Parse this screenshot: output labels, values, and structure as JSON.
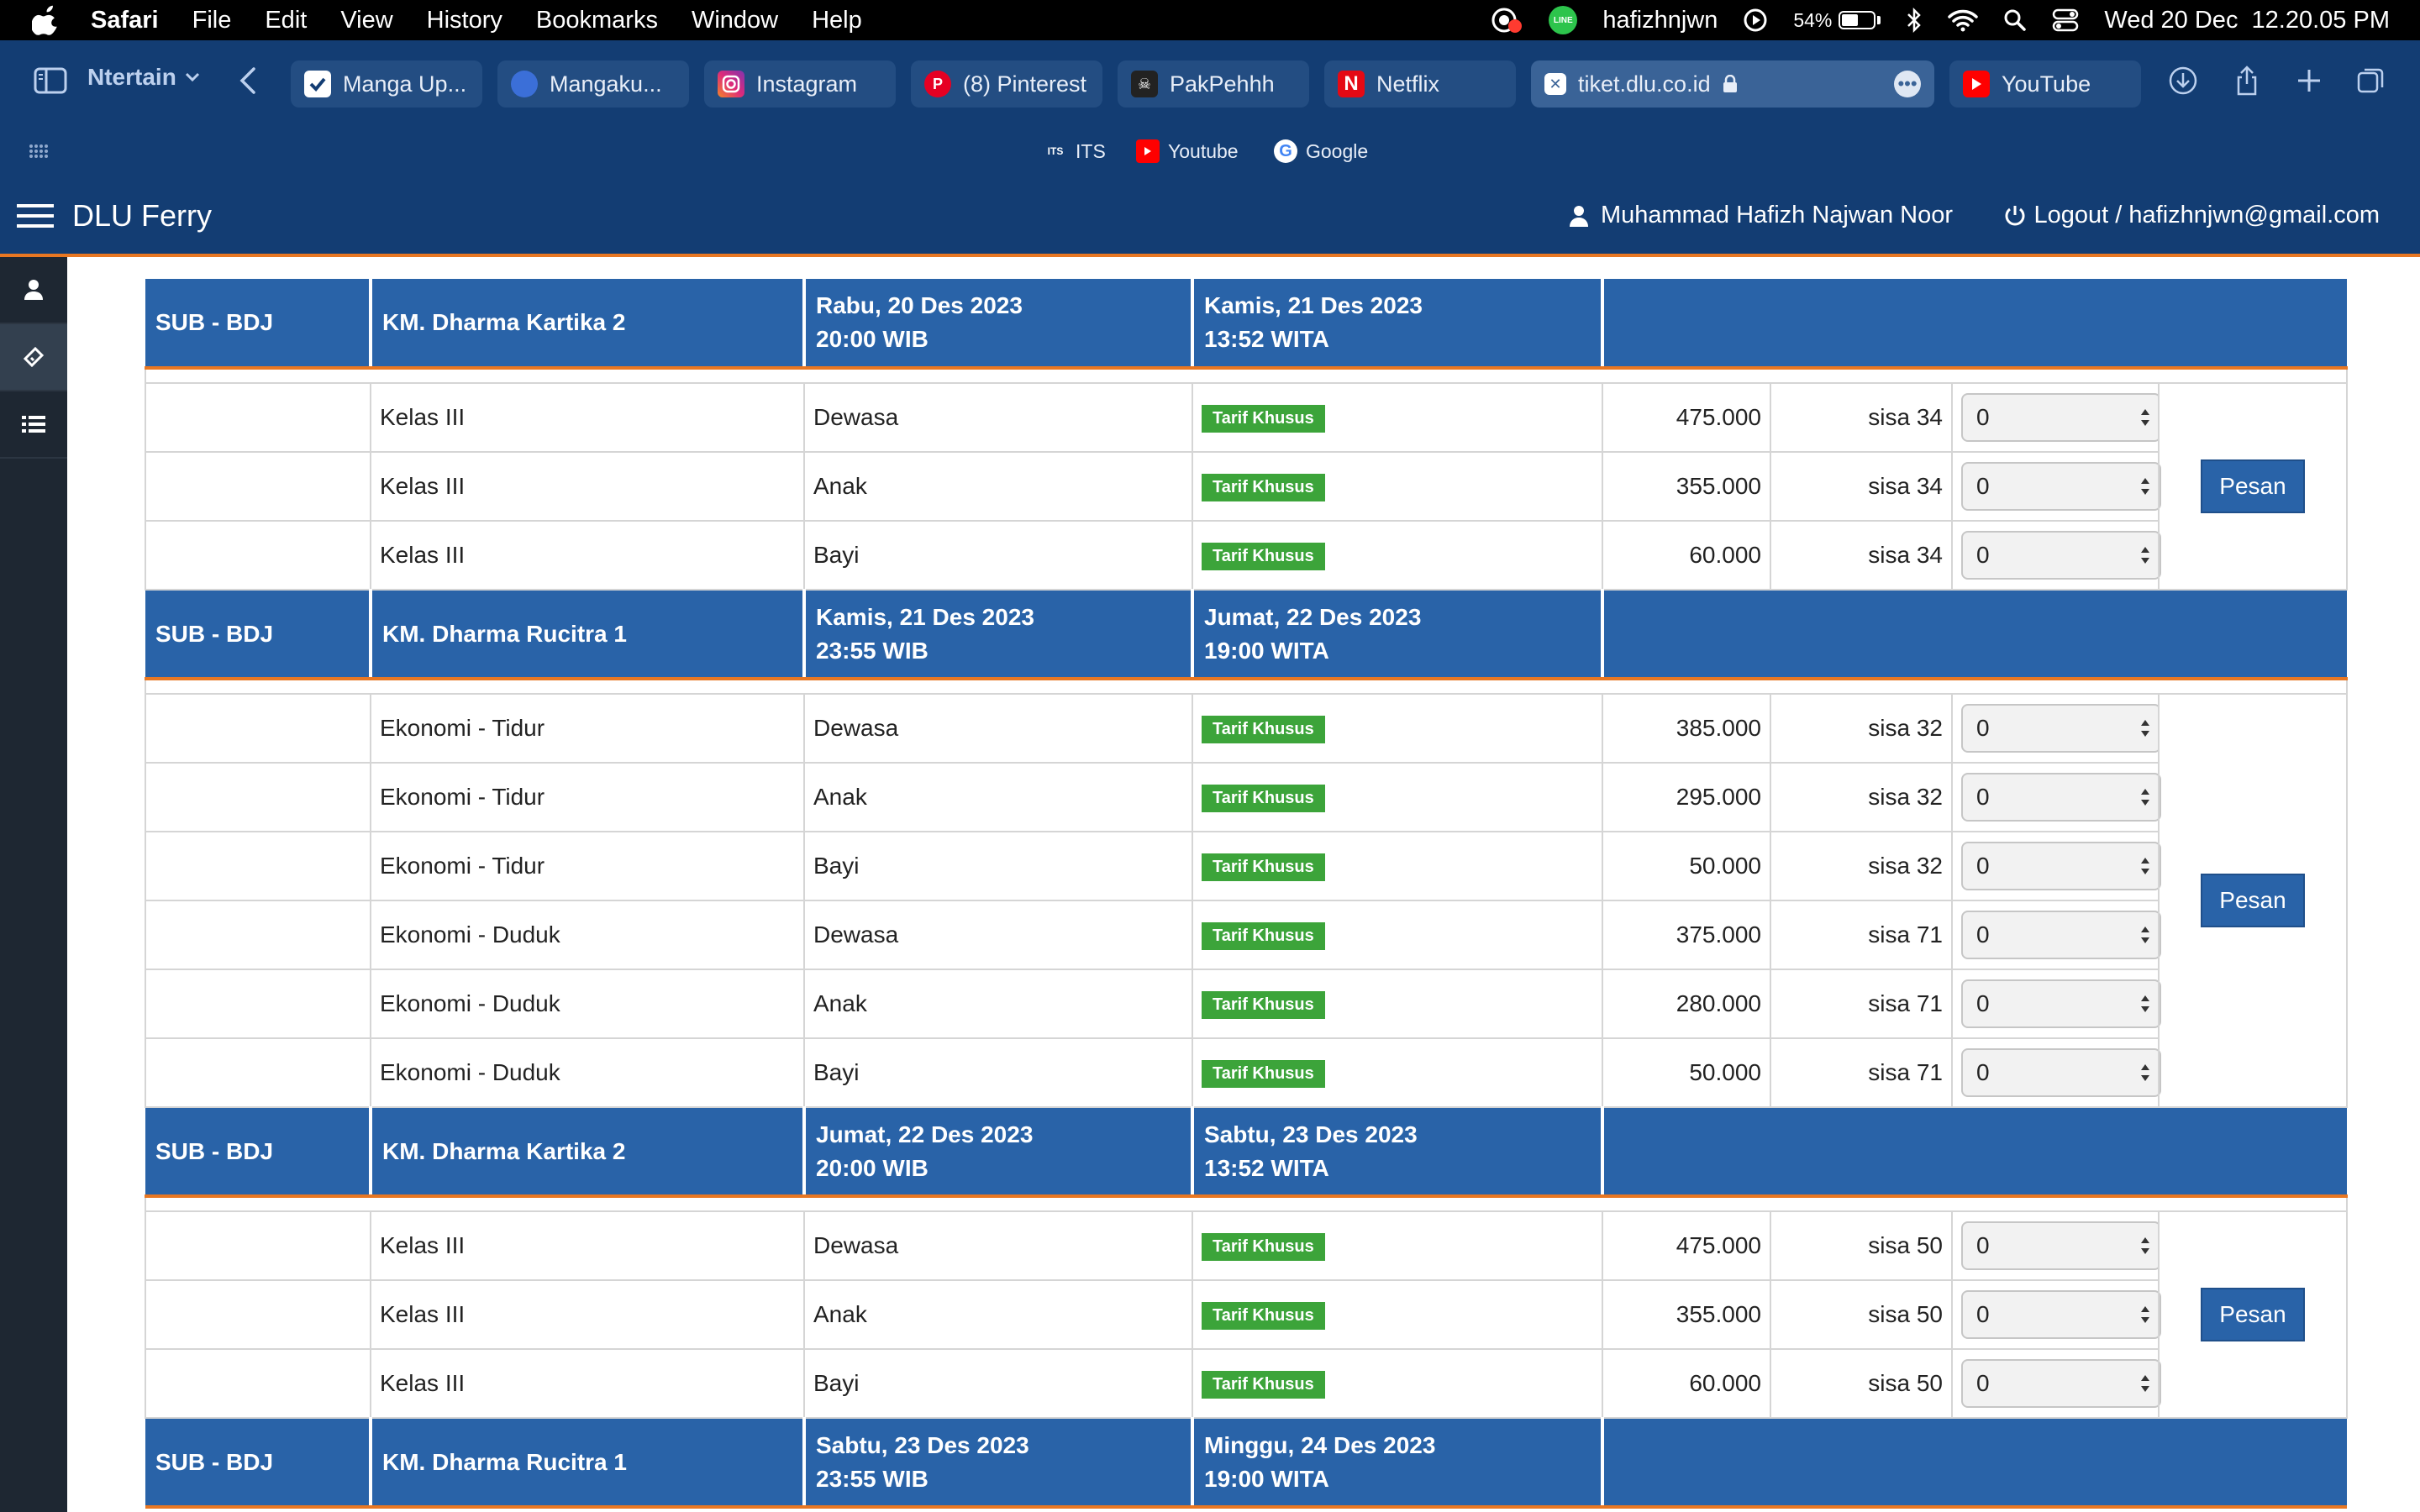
{
  "menubar": {
    "app": "Safari",
    "items": [
      "File",
      "Edit",
      "View",
      "History",
      "Bookmarks",
      "Window",
      "Help"
    ],
    "user": "hafizhnjwn",
    "battery_pct": "54%",
    "battery_level": 0.54,
    "datetime": "Wed 20 Dec  12.20.05 PM"
  },
  "toolbar": {
    "profile": "Ntertain",
    "tabs": [
      {
        "label": "Manga Up...",
        "icon": "manga-up-icon",
        "color": "#ffffff"
      },
      {
        "label": "Mangaku...",
        "icon": "mangaku-icon",
        "color": "#3b6fd8"
      },
      {
        "label": "Instagram",
        "icon": "instagram-icon",
        "color": "#d6249f"
      },
      {
        "label": "(8) Pinterest",
        "icon": "pinterest-icon",
        "color": "#e60023"
      },
      {
        "label": "PakPehhh",
        "icon": "pakpehhh-icon",
        "color": "#222222"
      },
      {
        "label": "Netflix",
        "icon": "netflix-icon",
        "color": "#e50914"
      },
      {
        "label": "tiket.dlu.co.id",
        "icon": "dlu-icon",
        "color": "#ffffff"
      },
      {
        "label": "YouTube",
        "icon": "youtube-icon",
        "color": "#ff0000"
      }
    ]
  },
  "favorites": [
    {
      "label": "ITS",
      "icon": "its-icon"
    },
    {
      "label": "Youtube",
      "icon": "youtube-icon"
    },
    {
      "label": "Google",
      "icon": "google-icon"
    }
  ],
  "site": {
    "brand": "DLU Ferry",
    "user_name": "Muhammad Hafizh Najwan Noor",
    "logout": "Logout / hafizhnjwn@gmail.com"
  },
  "colors": {
    "header_blue": "#133d73",
    "row_blue": "#2963a8",
    "accent_orange": "#e87722",
    "tarif_green": "#3ca43a"
  },
  "trips": [
    {
      "route": "SUB - BDJ",
      "ship": "KM. Dharma Kartika 2",
      "depart": [
        "Rabu, 20 Des 2023",
        "20:00 WIB"
      ],
      "arrive": [
        "Kamis, 21 Des 2023",
        "13:52 WITA"
      ],
      "action": "Pesan",
      "fares": [
        {
          "class": "Kelas III",
          "passenger": "Dewasa",
          "tag": "Tarif Khusus",
          "price": "475.000",
          "stock": "sisa 34",
          "qty": "0"
        },
        {
          "class": "Kelas III",
          "passenger": "Anak",
          "tag": "Tarif Khusus",
          "price": "355.000",
          "stock": "sisa 34",
          "qty": "0"
        },
        {
          "class": "Kelas III",
          "passenger": "Bayi",
          "tag": "Tarif Khusus",
          "price": "60.000",
          "stock": "sisa 34",
          "qty": "0"
        }
      ]
    },
    {
      "route": "SUB - BDJ",
      "ship": "KM. Dharma Rucitra 1",
      "depart": [
        "Kamis, 21 Des 2023",
        "23:55 WIB"
      ],
      "arrive": [
        "Jumat, 22 Des 2023",
        "19:00 WITA"
      ],
      "action": "Pesan",
      "fares": [
        {
          "class": "Ekonomi - Tidur",
          "passenger": "Dewasa",
          "tag": "Tarif Khusus",
          "price": "385.000",
          "stock": "sisa 32",
          "qty": "0"
        },
        {
          "class": "Ekonomi - Tidur",
          "passenger": "Anak",
          "tag": "Tarif Khusus",
          "price": "295.000",
          "stock": "sisa 32",
          "qty": "0"
        },
        {
          "class": "Ekonomi - Tidur",
          "passenger": "Bayi",
          "tag": "Tarif Khusus",
          "price": "50.000",
          "stock": "sisa 32",
          "qty": "0"
        },
        {
          "class": "Ekonomi - Duduk",
          "passenger": "Dewasa",
          "tag": "Tarif Khusus",
          "price": "375.000",
          "stock": "sisa 71",
          "qty": "0"
        },
        {
          "class": "Ekonomi - Duduk",
          "passenger": "Anak",
          "tag": "Tarif Khusus",
          "price": "280.000",
          "stock": "sisa 71",
          "qty": "0"
        },
        {
          "class": "Ekonomi - Duduk",
          "passenger": "Bayi",
          "tag": "Tarif Khusus",
          "price": "50.000",
          "stock": "sisa 71",
          "qty": "0"
        }
      ]
    },
    {
      "route": "SUB - BDJ",
      "ship": "KM. Dharma Kartika 2",
      "depart": [
        "Jumat, 22 Des 2023",
        "20:00 WIB"
      ],
      "arrive": [
        "Sabtu, 23 Des 2023",
        "13:52 WITA"
      ],
      "action": "Pesan",
      "fares": [
        {
          "class": "Kelas III",
          "passenger": "Dewasa",
          "tag": "Tarif Khusus",
          "price": "475.000",
          "stock": "sisa 50",
          "qty": "0"
        },
        {
          "class": "Kelas III",
          "passenger": "Anak",
          "tag": "Tarif Khusus",
          "price": "355.000",
          "stock": "sisa 50",
          "qty": "0"
        },
        {
          "class": "Kelas III",
          "passenger": "Bayi",
          "tag": "Tarif Khusus",
          "price": "60.000",
          "stock": "sisa 50",
          "qty": "0"
        }
      ]
    },
    {
      "route": "SUB - BDJ",
      "ship": "KM. Dharma Rucitra 1",
      "depart": [
        "Sabtu, 23 Des 2023",
        "23:55 WIB"
      ],
      "arrive": [
        "Minggu, 24 Des 2023",
        "19:00 WITA"
      ],
      "action": "",
      "fares": []
    }
  ]
}
